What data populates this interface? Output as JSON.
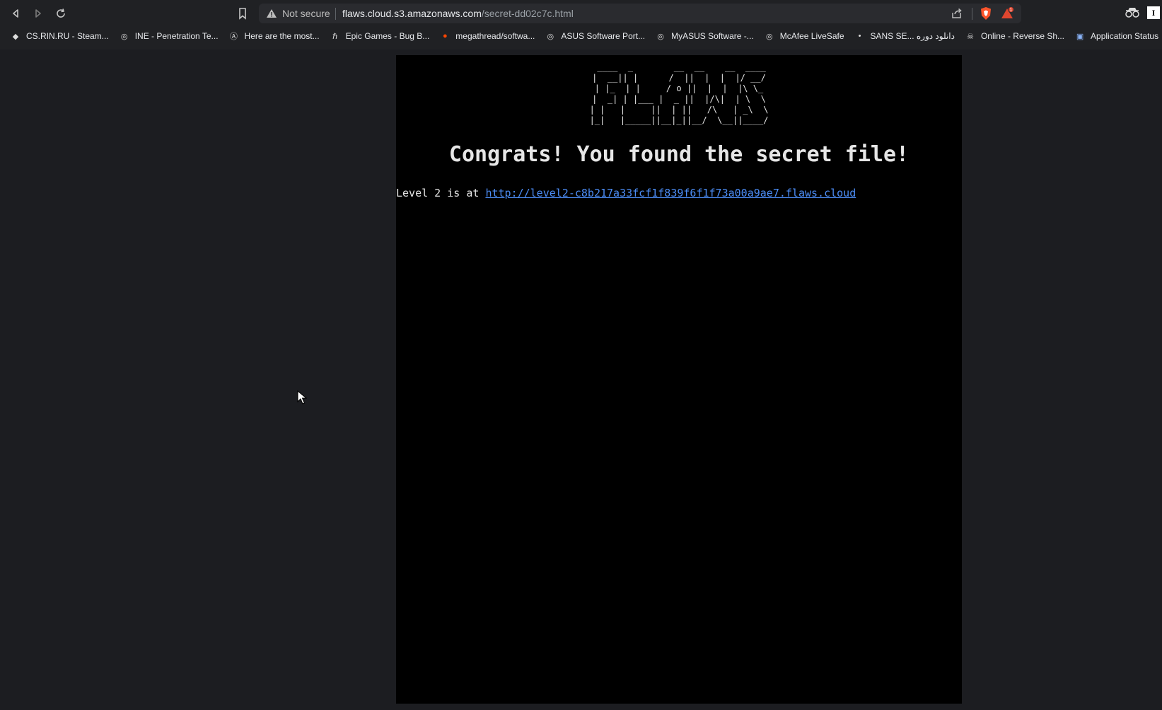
{
  "browser": {
    "security_label": "Not secure",
    "url_host": "flaws.cloud.s3.amazonaws.com",
    "url_path": "/secret-dd02c7c.html",
    "rewards_badge": "1",
    "bookmarks": [
      {
        "label": "CS.RIN.RU - Steam...",
        "icon": "cs-rin-favicon"
      },
      {
        "label": "INE - Penetration Te...",
        "icon": "globe-icon"
      },
      {
        "label": "Here are the most...",
        "icon": "a-logo-icon"
      },
      {
        "label": "Epic Games - Bug B...",
        "icon": "h-logo-icon"
      },
      {
        "label": "megathread/softwa...",
        "icon": "reddit-icon"
      },
      {
        "label": "ASUS Software Port...",
        "icon": "globe-icon"
      },
      {
        "label": "MyASUS Software -...",
        "icon": "globe-icon"
      },
      {
        "label": "McAfee LiveSafe",
        "icon": "globe-icon"
      },
      {
        "label": "SANS SE... دانلود دوره",
        "icon": "sans-icon"
      },
      {
        "label": "Online - Reverse Sh...",
        "icon": "skull-icon"
      },
      {
        "label": "Application Status",
        "icon": "app-status-icon"
      }
    ]
  },
  "page": {
    "ascii_logo": " ____  _        __  __    __  ____\n|  __|| |      /  ||  |  |  |/ __/\n| |_  | |     / o ||  |  |  |\\ \\_\n|  _| | |___ |  _ ||  |/\\|  | \\  \\\n| |   |     ||  | ||   /\\   | _\\  \\\n|_|   |_____||__|_||__/  \\__||____/",
    "headline": "Congrats! You found the secret file!",
    "level_prefix": "Level 2 is at ",
    "level_link": "http://level2-c8b217a33fcf1f839f6f1f73a00a9ae7.flaws.cloud"
  },
  "colors": {
    "link": "#4c8df6",
    "page_bg": "#000000",
    "browser_bg": "#1c1d21"
  }
}
